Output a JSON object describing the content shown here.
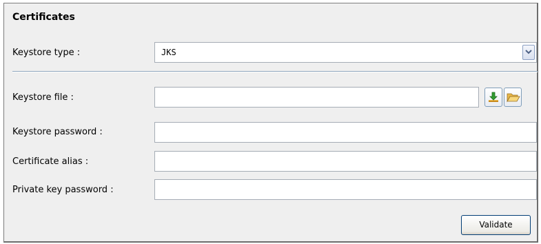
{
  "section": {
    "title": "Certificates"
  },
  "keystore_type": {
    "label": "Keystore type :",
    "selected": "JKS"
  },
  "keystore_file": {
    "label": "Keystore file :",
    "value": "",
    "download_icon": "download-icon",
    "open_icon": "folder-open-icon"
  },
  "keystore_password": {
    "label": "Keystore password :",
    "value": ""
  },
  "certificate_alias": {
    "label": "Certificate alias :",
    "value": ""
  },
  "private_key_password": {
    "label": "Private key password :",
    "value": ""
  },
  "actions": {
    "validate_label": "Validate"
  },
  "colors": {
    "panel_bg": "#efefef",
    "border": "#7c7c7c",
    "separator": "#8ea6bd",
    "button_border": "#003c74"
  }
}
